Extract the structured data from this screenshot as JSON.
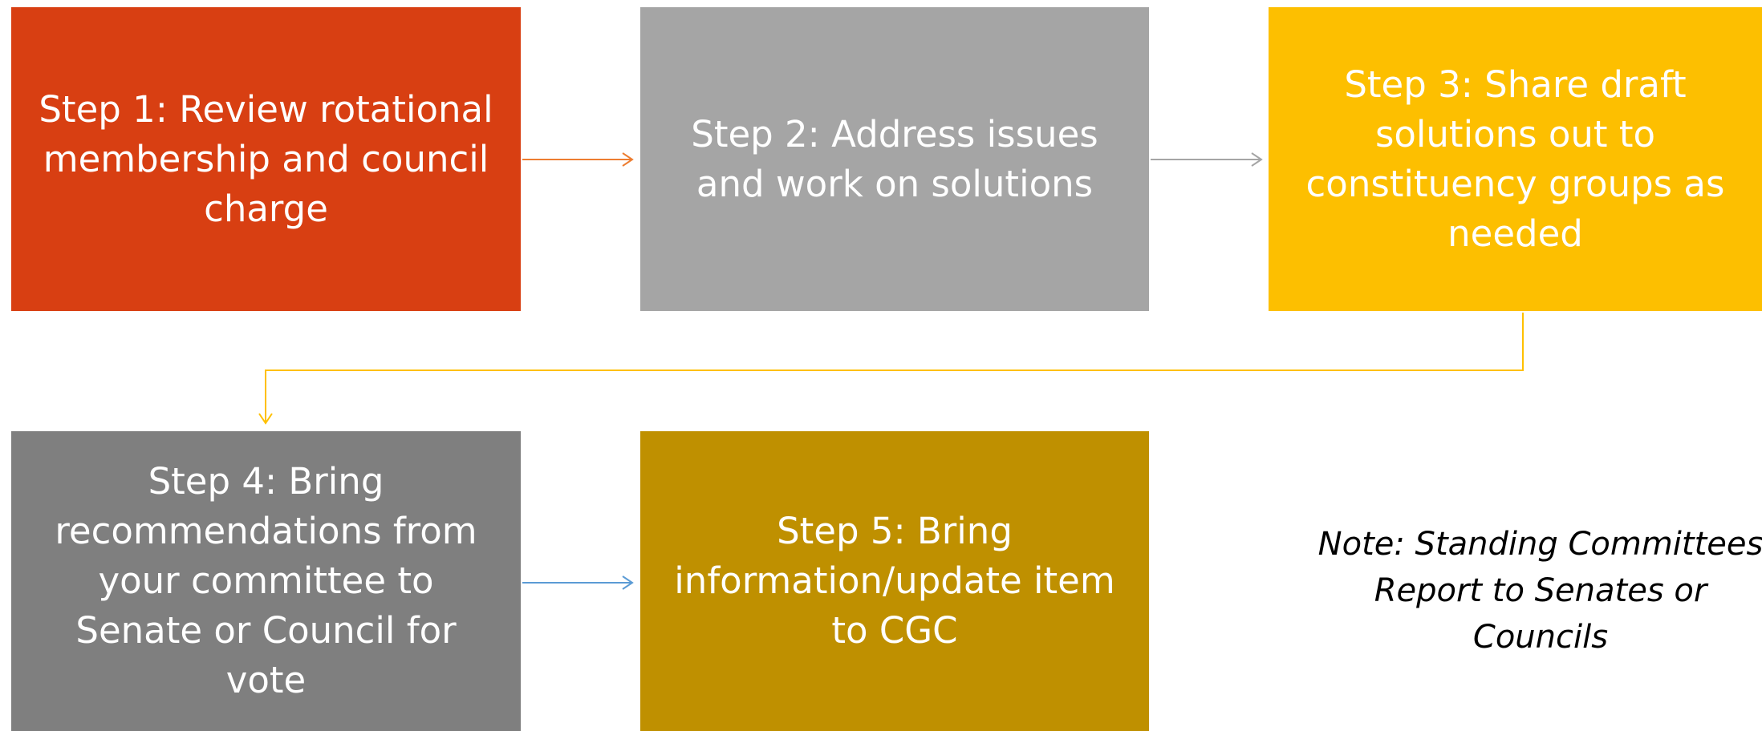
{
  "steps": [
    {
      "label": "Step 1: Review rotational membership and council charge",
      "color": "#d83f12"
    },
    {
      "label": "Step 2: Address issues and work on solutions",
      "color": "#a5a5a5"
    },
    {
      "label": "Step 3: Share draft solutions out to constituency groups as needed",
      "color": "#fdbf00"
    },
    {
      "label": "Step 4: Bring recommendations from your committee to Senate or Council for vote",
      "color": "#7f7f7f"
    },
    {
      "label": "Step 5: Bring information/update item to CGC",
      "color": "#bf9000"
    }
  ],
  "note": "Note: Standing Committees Report to Senates or Councils",
  "connector_colors": {
    "step1_to_step2": "#ed7d31",
    "step2_to_step3": "#a5a5a5",
    "step3_to_step4": "#ffc000",
    "step4_to_step5": "#5b9bd5"
  },
  "text_color": "#ffffff"
}
